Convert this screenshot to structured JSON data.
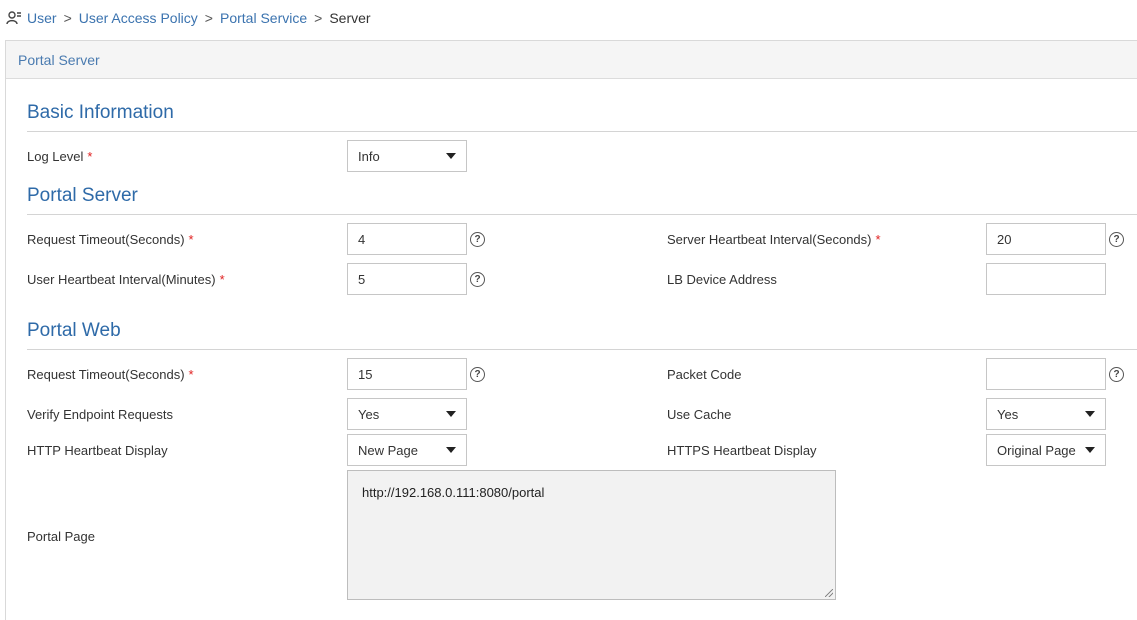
{
  "breadcrumb": {
    "items": [
      "User",
      "User Access Policy",
      "Portal Service"
    ],
    "separator": ">",
    "current": "Server"
  },
  "panel": {
    "title": "Portal Server"
  },
  "basic": {
    "title": "Basic Information",
    "log_level": {
      "label": "Log Level",
      "value": "Info"
    }
  },
  "portal_server": {
    "title": "Portal Server",
    "request_timeout": {
      "label": "Request Timeout(Seconds)",
      "value": "4"
    },
    "server_heartbeat": {
      "label": "Server Heartbeat Interval(Seconds)",
      "value": "20"
    },
    "user_heartbeat": {
      "label": "User Heartbeat Interval(Minutes)",
      "value": "5"
    },
    "lb_device": {
      "label": "LB Device Address",
      "value": ""
    }
  },
  "portal_web": {
    "title": "Portal Web",
    "request_timeout": {
      "label": "Request Timeout(Seconds)",
      "value": "15"
    },
    "packet_code": {
      "label": "Packet Code",
      "value": ""
    },
    "verify_endpoint": {
      "label": "Verify Endpoint Requests",
      "value": "Yes"
    },
    "use_cache": {
      "label": "Use Cache",
      "value": "Yes"
    },
    "http_heartbeat": {
      "label": "HTTP Heartbeat Display",
      "value": "New Page"
    },
    "https_heartbeat": {
      "label": "HTTPS Heartbeat Display",
      "value": "Original Page"
    },
    "portal_page": {
      "label": "Portal Page",
      "value": "http://192.168.0.111:8080/portal"
    }
  },
  "required_mark": "*",
  "help_glyph": "?",
  "colors": {
    "link": "#3b73af",
    "section": "#2e6aa8",
    "required": "#e02020"
  }
}
